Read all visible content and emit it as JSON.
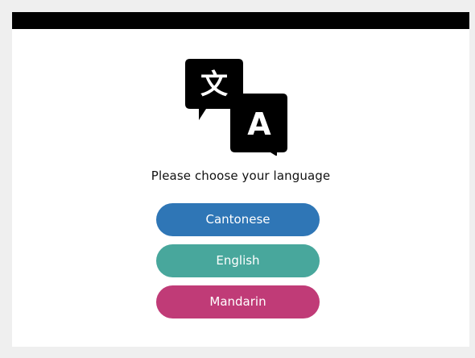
{
  "header": {
    "prompt": "Please choose your language"
  },
  "icon": {
    "name": "translate-icon",
    "glyph_left": "文",
    "glyph_right": "A"
  },
  "languages": [
    {
      "label": "Cantonese",
      "color": "#2f76b6"
    },
    {
      "label": "English",
      "color": "#48a79c"
    },
    {
      "label": "Mandarin",
      "color": "#c03b77"
    }
  ]
}
